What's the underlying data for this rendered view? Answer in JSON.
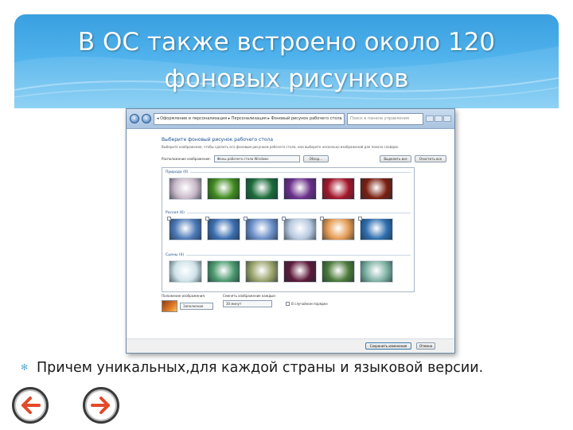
{
  "slide": {
    "title_line1": "В ОС также встроено около 120",
    "title_line2": "фоновых рисунков",
    "bullet_text": "Причем уникальных,для каждой страны и языковой версии.",
    "accent_color": "#3a9fe0",
    "arrow_color": "#e24a2a",
    "nav": {
      "back_icon": "arrow-left-icon",
      "next_icon": "arrow-right-icon"
    }
  },
  "window": {
    "address": "◂ Оформление и персонализация ▸ Персонализация ▸ Фоновый рисунок рабочего стола",
    "search_placeholder": "Поиск в панели управления",
    "heading": "Выберите фоновый рисунок рабочего стола",
    "description": "Выберите изображение, чтобы сделать его фоновым рисунком рабочего стола, или выберите несколько изображений для показа слайдов.",
    "location_label": "Расположение изображения:",
    "location_value": "Фоны рабочего стола Windows",
    "browse_button": "Обзор...",
    "select_all_button": "Выделить все",
    "clear_all_button": "Очистить все",
    "groups": [
      {
        "label": "Природа (6)",
        "colors": [
          "#c9b9c9",
          "#3f8a1e",
          "#1c6b3a",
          "#6a2f8a",
          "#a3162a",
          "#7a1f10"
        ]
      },
      {
        "label": "Россия (6)",
        "colors": [
          "#4d7ab8",
          "#3c6fb1",
          "#6b8fc9",
          "#b8c9e0",
          "#e59a52",
          "#2f6fb0"
        ]
      },
      {
        "label": "Сцены (6)",
        "colors": [
          "#cfe3ea",
          "#4c9a6e",
          "#9aa36b",
          "#5c1a3a",
          "#4b7a3a",
          "#7fb3a3"
        ]
      }
    ],
    "position_label": "Положение изображения:",
    "position_value": "Заполнение",
    "interval_label": "Сменять изображение каждые:",
    "interval_value": "30 минут",
    "shuffle_label": "В случайном порядке",
    "save_button": "Сохранить изменения",
    "cancel_button": "Отмена"
  }
}
